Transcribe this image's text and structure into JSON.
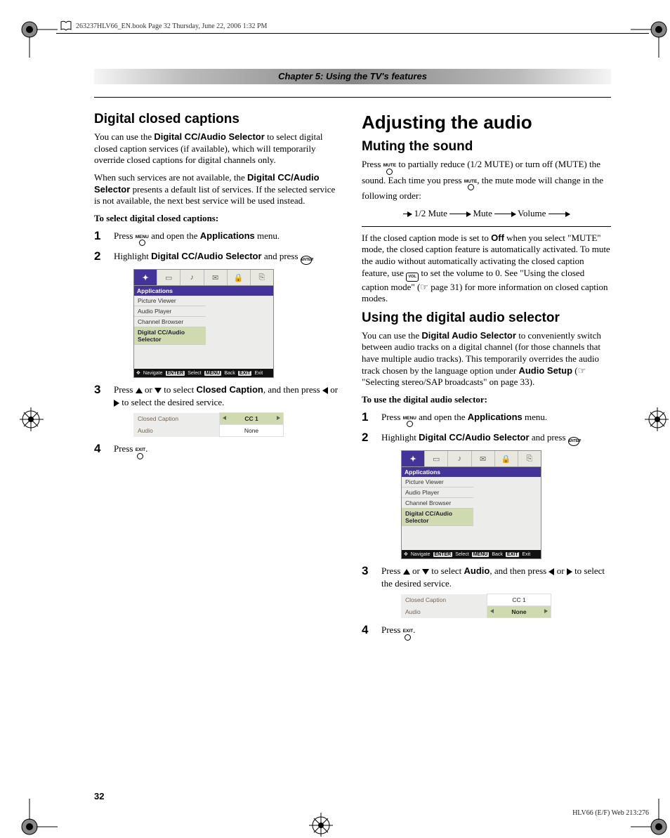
{
  "header": "263237HLV66_EN.book  Page 32  Thursday, June 22, 2006  1:32 PM",
  "chapter": "Chapter 5: Using the TV's features",
  "left": {
    "h2": "Digital closed captions",
    "p1a": "You can use the ",
    "p1b": "Digital CC/Audio Selector",
    "p1c": " to select digital closed caption services (if available), which will temporarily override closed captions for digital channels only.",
    "p2a": "When such services are not available, the ",
    "p2b": "Digital CC/Audio Selector",
    "p2c": " presents a default list of services. If the selected service is not available, the next best service will be used instead.",
    "sub": "To select digital closed captions:",
    "s1a": "Press ",
    "menuBtn": "MENU",
    "s1b": " and open the ",
    "s1c": "Applications",
    "s1d": " menu.",
    "s2a": "Highlight ",
    "s2b": "Digital CC/Audio Selector",
    "s2c": " and press ",
    "enterBtn": "ENTER",
    "s2d": ".",
    "s3a": "Press ",
    "s3b": " or ",
    "s3c": " to select ",
    "s3d": "Closed Caption",
    "s3e": ", and then press ",
    "s3f": " or ",
    "s3g": " to select the desired service.",
    "s4a": "Press ",
    "exitBtn": "EXIT",
    "s4b": "."
  },
  "osd": {
    "heading": "Applications",
    "items": [
      "Picture Viewer",
      "Audio Player",
      "Channel Browser",
      "Digital CC/Audio Selector"
    ],
    "footer": {
      "nav": "Navigate",
      "sel": "Select",
      "back": "Back",
      "exit": "Exit",
      "k1": "ENTER",
      "k2": "MENU",
      "k3": "EXIT"
    }
  },
  "sel": {
    "cc_label": "Closed Caption",
    "cc_val": "CC 1",
    "au_label": "Audio",
    "au_val": "None"
  },
  "right": {
    "h1": "Adjusting the audio",
    "h2a": "Muting the sound",
    "muteBtn": "MUTE",
    "m1a": "Press ",
    "m1b": " to partially reduce (1/2 MUTE) or turn off (MUTE) the sound. Each time you press ",
    "m1c": ", the mute mode will change in the following order:",
    "flow": {
      "a": "1/2 Mute",
      "b": "Mute",
      "c": "Volume"
    },
    "m2a": "If the closed caption mode is set to ",
    "m2b": "Off",
    "m2c": " when you select \"MUTE\" mode, the closed caption feature is automatically activated. To mute the audio without automatically activating the closed caption feature, use ",
    "volBtn": "VOL",
    "m2d": " to set the volume to 0. See \"Using the closed caption mode\" (",
    "m2e": " page 31) for more information on closed caption modes.",
    "h2b": "Using the digital audio selector",
    "d1a": "You can use the ",
    "d1b": "Digital Audio Selector",
    "d1c": " to conveniently switch between audio tracks on a digital channel (for those channels that have multiple audio tracks). This temporarily overrides the audio track chosen by the language option under ",
    "d1d": "Audio Setup",
    "d1e": " (",
    "d1f": " \"Selecting stereo/SAP broadcasts\" on page 33).",
    "sub": "To use the digital audio selector:",
    "s1a": "Press ",
    "s1b": " and open the ",
    "s1c": "Applications",
    "s1d": " menu.",
    "s2a": "Highlight ",
    "s2b": "Digital CC/Audio Selector",
    "s2c": " and press ",
    "s2d": ".",
    "s3a": "Press ",
    "s3b": " or ",
    "s3c": " to select ",
    "s3d": "Audio",
    "s3e": ", and then press ",
    "s3f": " or ",
    "s3g": " to select the desired service.",
    "s4a": "Press ",
    "s4b": "."
  },
  "pageNum": "32",
  "footer": "HLV66 (E/F) Web 213:276"
}
